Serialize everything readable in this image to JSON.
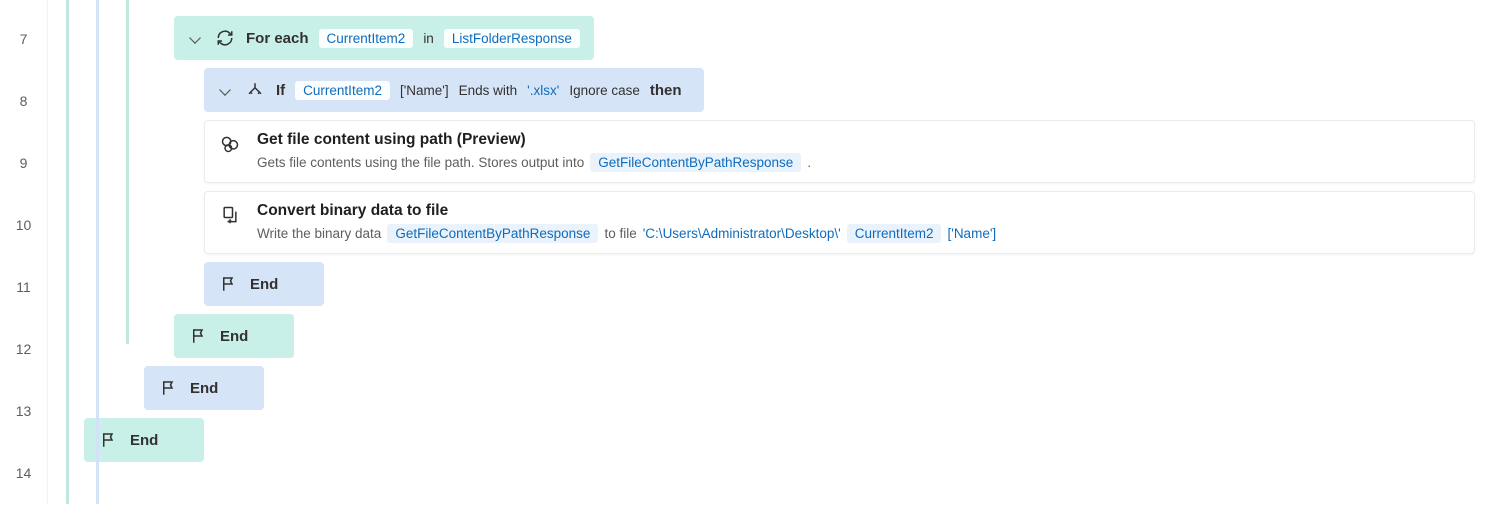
{
  "lines": {
    "l7": "7",
    "l8": "8",
    "l9": "9",
    "l10": "10",
    "l11": "11",
    "l12": "12",
    "l13": "13",
    "l14": "14"
  },
  "forEach": {
    "keyword": "For each",
    "var": "CurrentItem2",
    "in": "in",
    "collection": "ListFolderResponse"
  },
  "ifBlock": {
    "keyword": "If",
    "var": "CurrentItem2",
    "prop": "['Name']",
    "op": "Ends with",
    "literal": "'.xlsx'",
    "flag": "Ignore case",
    "then": "then"
  },
  "action1": {
    "title": "Get file content using path (Preview)",
    "descPrefix": "Gets file contents using the file path. Stores output into",
    "outputVar": "GetFileContentByPathResponse",
    "descSuffix": "."
  },
  "action2": {
    "title": "Convert binary data to file",
    "descPrefix": "Write the binary data",
    "inputVar": "GetFileContentByPathResponse",
    "mid": "to file",
    "pathLiteral": "'C:\\Users\\Administrator\\Desktop\\'",
    "itemVar": "CurrentItem2",
    "prop": "['Name']"
  },
  "endLabel": "End"
}
